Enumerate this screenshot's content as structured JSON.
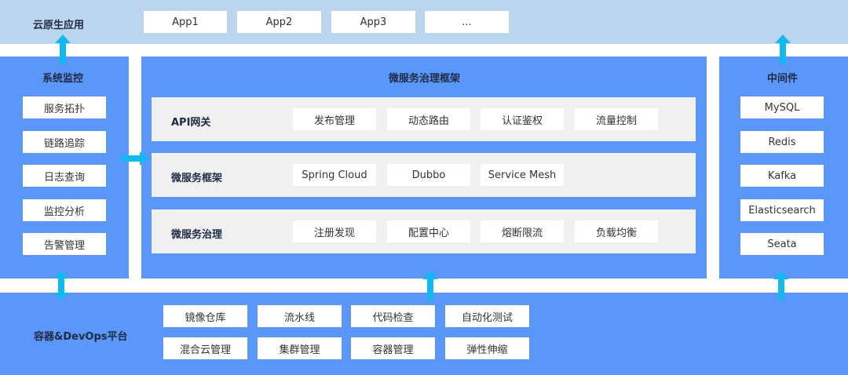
{
  "cloud_native_apps": {
    "title": "云原生应用",
    "apps": [
      "App1",
      "App2",
      "App3",
      "..."
    ]
  },
  "monitoring": {
    "title": "系统监控",
    "items": [
      "服务拓扑",
      "链路追踪",
      "日志查询",
      "监控分析",
      "告警管理"
    ]
  },
  "governance": {
    "title": "微服务治理框架",
    "rows": [
      {
        "label": "API网关",
        "items": [
          "发布管理",
          "动态路由",
          "认证鉴权",
          "流量控制"
        ]
      },
      {
        "label": "微服务框架",
        "items": [
          "Spring Cloud",
          "Dubbo",
          "Service Mesh"
        ]
      },
      {
        "label": "微服务治理",
        "items": [
          "注册发现",
          "配置中心",
          "熔断限流",
          "负载均衡"
        ]
      }
    ]
  },
  "middleware": {
    "title": "中间件",
    "items": [
      "MySQL",
      "Redis",
      "Kafka",
      "Elasticsearch",
      "Seata"
    ]
  },
  "devops": {
    "title": "容器&DevOps平台",
    "row1": [
      "镜像仓库",
      "流水线",
      "代码检查",
      "自动化测试"
    ],
    "row2": [
      "混合云管理",
      "集群管理",
      "容器管理",
      "弹性伸缩"
    ]
  },
  "colors": {
    "top_band": "#bcd6ef",
    "panel_blue": "#5b97f8",
    "arrow_cyan": "#14b8f0",
    "row_gray": "#f0f0f0"
  }
}
